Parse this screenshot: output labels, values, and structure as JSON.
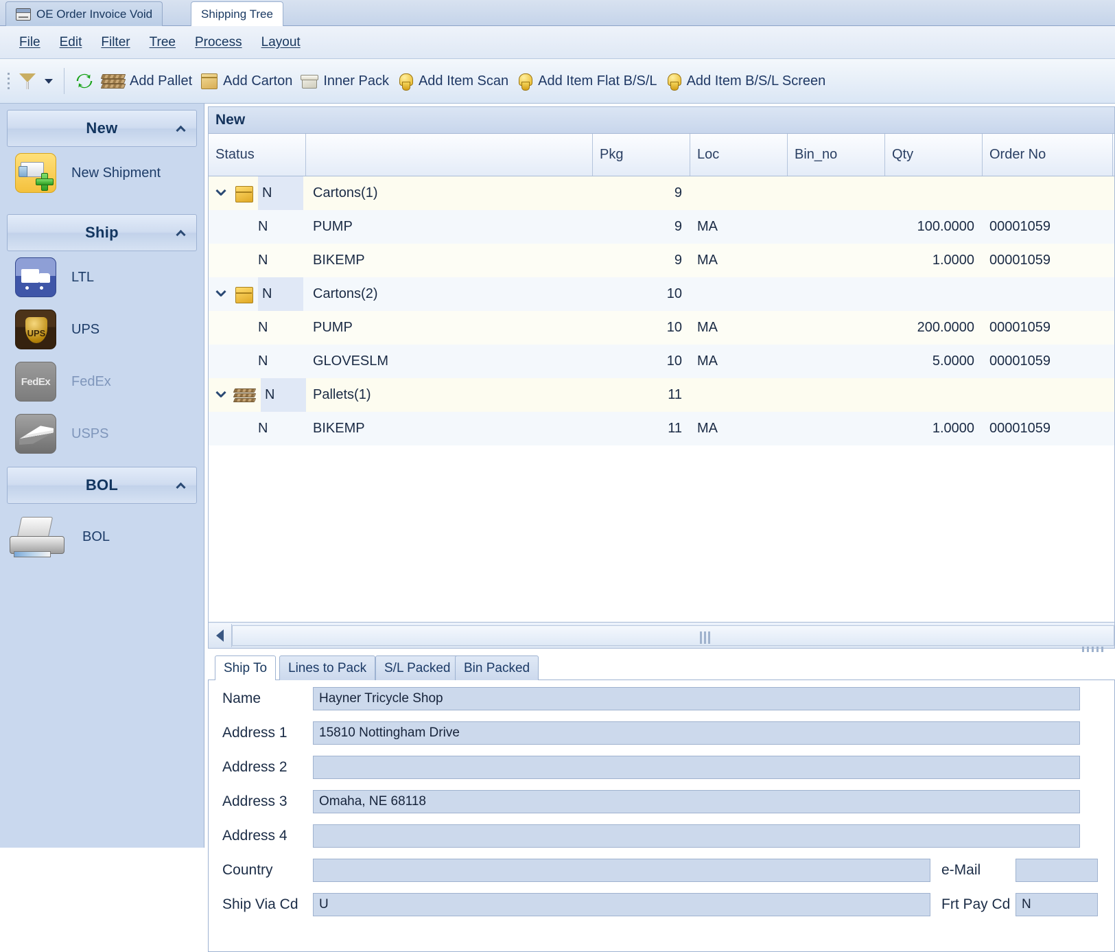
{
  "window": {
    "tabs": [
      {
        "label": "OE Order Invoice Void",
        "active": false
      },
      {
        "label": "Shipping Tree",
        "active": true
      }
    ]
  },
  "menubar": {
    "items": [
      "File",
      "Edit",
      "Filter",
      "Tree",
      "Process",
      "Layout"
    ]
  },
  "toolbar": {
    "filter_label": "",
    "buttons": [
      {
        "label": "Add Pallet",
        "icon": "pallet-icon"
      },
      {
        "label": "Add Carton",
        "icon": "carton-icon"
      },
      {
        "label": "Inner Pack",
        "icon": "inner-pack-icon"
      },
      {
        "label": "Add Item Scan",
        "icon": "badge-icon"
      },
      {
        "label": "Add Item Flat B/S/L",
        "icon": "badge-icon"
      },
      {
        "label": "Add Item B/S/L Screen",
        "icon": "badge-icon"
      }
    ]
  },
  "sidebar": {
    "groups": [
      {
        "title": "New",
        "items": [
          {
            "label": "New Shipment",
            "icon": "new-shipment-icon",
            "disabled": false
          }
        ]
      },
      {
        "title": "Ship",
        "items": [
          {
            "label": "LTL",
            "icon": "ltl-truck-icon",
            "disabled": false
          },
          {
            "label": "UPS",
            "icon": "ups-icon",
            "disabled": false
          },
          {
            "label": "FedEx",
            "icon": "fedex-icon",
            "disabled": true
          },
          {
            "label": "USPS",
            "icon": "usps-icon",
            "disabled": true
          }
        ]
      },
      {
        "title": "BOL",
        "items": [
          {
            "label": "BOL",
            "icon": "printer-icon",
            "disabled": false
          }
        ]
      }
    ]
  },
  "grid": {
    "caption": "New",
    "columns": [
      {
        "key": "status",
        "label": "Status"
      },
      {
        "key": "desc",
        "label": ""
      },
      {
        "key": "pkg",
        "label": "Pkg"
      },
      {
        "key": "loc",
        "label": "Loc"
      },
      {
        "key": "bin_no",
        "label": "Bin_no"
      },
      {
        "key": "qty",
        "label": "Qty"
      },
      {
        "key": "order_no",
        "label": "Order No"
      }
    ],
    "rows": [
      {
        "type": "group",
        "icon": "carton-icon",
        "status": "N",
        "desc": "Cartons(1)",
        "pkg": "9",
        "loc": "",
        "bin_no": "",
        "qty": "",
        "order_no": ""
      },
      {
        "type": "child",
        "icon": "",
        "status": "N",
        "desc": "PUMP",
        "pkg": "9",
        "loc": "MA",
        "bin_no": "",
        "qty": "100.0000",
        "order_no": "00001059"
      },
      {
        "type": "child",
        "icon": "",
        "status": "N",
        "desc": "BIKEMP",
        "pkg": "9",
        "loc": "MA",
        "bin_no": "",
        "qty": "1.0000",
        "order_no": "00001059"
      },
      {
        "type": "group",
        "icon": "carton-icon",
        "status": "N",
        "desc": "Cartons(2)",
        "pkg": "10",
        "loc": "",
        "bin_no": "",
        "qty": "",
        "order_no": ""
      },
      {
        "type": "child",
        "icon": "",
        "status": "N",
        "desc": "PUMP",
        "pkg": "10",
        "loc": "MA",
        "bin_no": "",
        "qty": "200.0000",
        "order_no": "00001059"
      },
      {
        "type": "child",
        "icon": "",
        "status": "N",
        "desc": "GLOVESLM",
        "pkg": "10",
        "loc": "MA",
        "bin_no": "",
        "qty": "5.0000",
        "order_no": "00001059"
      },
      {
        "type": "group",
        "icon": "pallet-icon",
        "status": "N",
        "desc": "Pallets(1)",
        "pkg": "11",
        "loc": "",
        "bin_no": "",
        "qty": "",
        "order_no": ""
      },
      {
        "type": "child",
        "icon": "",
        "status": "N",
        "desc": "BIKEMP",
        "pkg": "11",
        "loc": "MA",
        "bin_no": "",
        "qty": "1.0000",
        "order_no": "00001059"
      }
    ]
  },
  "bottom": {
    "tabs": [
      {
        "label": "Ship To",
        "active": true
      },
      {
        "label": "Lines to Pack",
        "active": false
      },
      {
        "label": "S/L Packed",
        "active": false
      },
      {
        "label": "Bin Packed",
        "active": false
      }
    ],
    "form": {
      "name_label": "Name",
      "name_value": "Hayner Tricycle Shop",
      "address1_label": "Address 1",
      "address1_value": "15810 Nottingham Drive",
      "address2_label": "Address 2",
      "address2_value": "",
      "address3_label": "Address 3",
      "address3_value": "Omaha, NE 68118",
      "address4_label": "Address 4",
      "address4_value": "",
      "country_label": "Country",
      "country_value": "",
      "email_label": "e-Mail",
      "email_value": "",
      "shipvia_label": "Ship Via Cd",
      "shipvia_value": "U",
      "frtpay_label": "Frt Pay Cd",
      "frtpay_value": "N"
    }
  },
  "colors": {
    "accent": "#17365d",
    "nav_bg": "#c9d8ee",
    "field_bg": "#ccd9ec"
  }
}
